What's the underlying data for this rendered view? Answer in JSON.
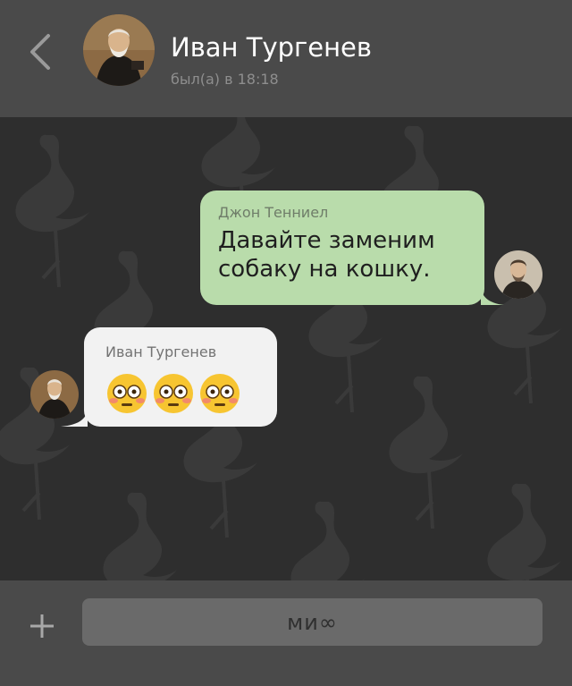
{
  "header": {
    "contact_name": "Иван Тургенев",
    "last_seen": "был(а) в 18:18",
    "back_icon": "chevron-left-icon",
    "avatar": "portrait-avatar"
  },
  "messages": [
    {
      "direction": "outgoing",
      "sender": "Джон Тенниел",
      "text": "Давайте заменим собаку на кошку.",
      "bubble_color": "#b9dcab"
    },
    {
      "direction": "incoming",
      "sender": "Иван Тургенев",
      "emojis": [
        "flushed-face-emoji",
        "flushed-face-emoji",
        "flushed-face-emoji"
      ],
      "bubble_color": "#f2f2f2"
    }
  ],
  "composer": {
    "placeholder": "ми∞",
    "attach_icon": "plus-icon"
  },
  "colors": {
    "bar_background": "#4a4a4a",
    "chat_background": "#2e2e2e",
    "outgoing_bubble": "#b9dcab",
    "incoming_bubble": "#f2f2f2"
  }
}
